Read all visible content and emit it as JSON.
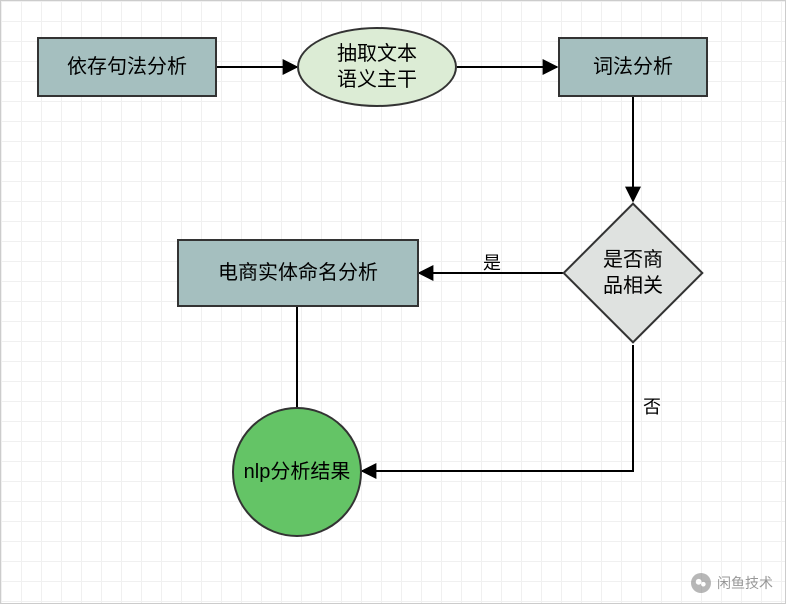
{
  "nodes": {
    "dep_parse": {
      "label": "依存句法分析"
    },
    "extract": {
      "label_l1": "抽取文本",
      "label_l2": "语义主干"
    },
    "lex": {
      "label": "词法分析"
    },
    "decision": {
      "label_l1": "是否商",
      "label_l2": "品相关"
    },
    "ner": {
      "label": "电商实体命名分析"
    },
    "result": {
      "label": "nlp分析结果"
    }
  },
  "edges": {
    "yes_label": "是",
    "no_label": "否"
  },
  "watermark": {
    "text": "闲鱼技术"
  },
  "colors": {
    "teal_box": "#a5bfbf",
    "ellipse": "#dcecd5",
    "diamond": "#dfe2e0",
    "circle": "#64c466",
    "stroke": "#333333"
  }
}
